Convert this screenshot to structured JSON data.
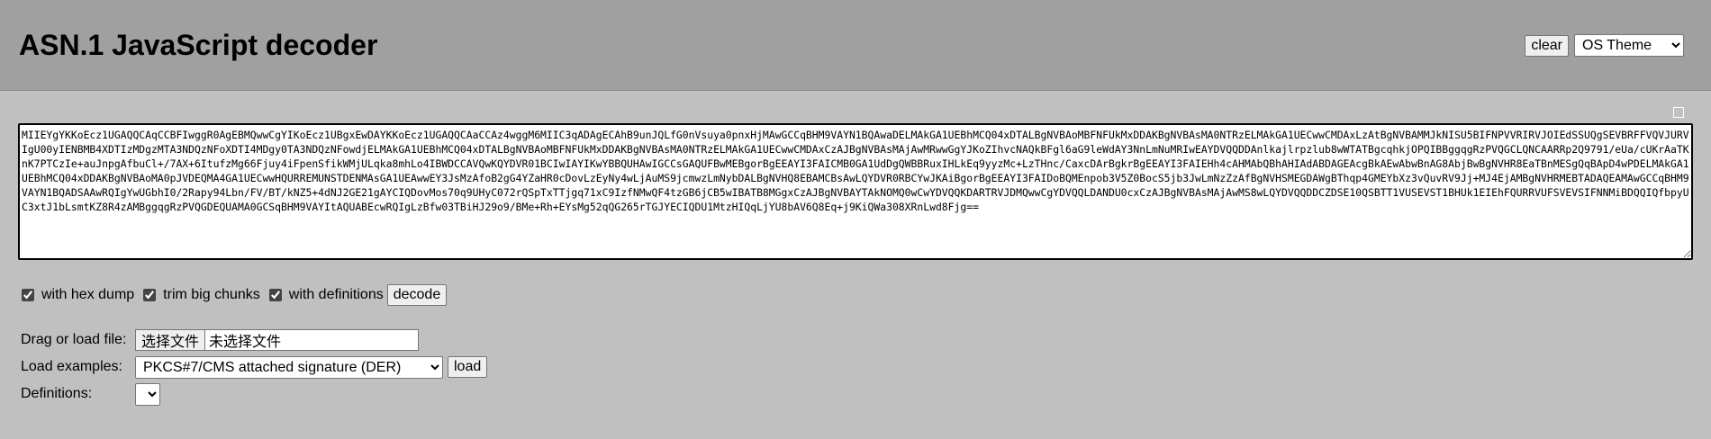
{
  "header": {
    "title": "ASN.1 JavaScript decoder",
    "clear_label": "clear",
    "theme_selected": "OS Theme"
  },
  "input": {
    "value": "MIIEYgYKKoEcz1UGAQQCAqCCBFIwggR0AgEBMQwwCgYIKoEcz1UBgxEwDAYKKoEcz1UGAQQCAaCCAz4wggM6MIIC3qADAgECAhB9unJQLfG0nVsuya0pnxHjMAwGCCqBHM9VAYN1BQAwaDELMAkGA1UEBhMCQ04xDTALBgNVBAoMBFNFUkMxDDAKBgNVBAsMA0NTRzELMAkGA1UECwwCMDAxLzAtBgNVBAMMJkNISU5BIFNPVVRIRVJOIEdSSUQgSEVBRFFVQVJURVIgU00yIENBMB4XDTIzMDgzMTA3NDQzNFoXDTI4MDgy0TA3NDQzNFowdjELMAkGA1UEBhMCQ04xDTALBgNVBAoMBFNFUkMxDDAKBgNVBAsMA0NTRzELMAkGA1UECwwCMDAxCzAJBgNVBAsMAjAwMRwwGgYJKoZIhvcNAQkBFgl6aG9leWdAY3NnLmNuMRIwEAYDVQQDDAnlkajlrpzlub8wWTATBgcqhkjOPQIBBggqgRzPVQGCLQNCAARRp2Q9791/eUa/cUKrAaTKnK7PTCzIe+auJnpgAfbuCl+/7AX+6ItufzMg66Fjuy4iFpenSfikWMjULqka8mhLo4IBWDCCAVQwKQYDVR01BCIwIAYIKwYBBQUHAwIGCCsGAQUFBwMEBgorBgEEAYI3FAICMB0GA1UdDgQWBBRuxIHLkEq9yyzMc+LzTHnc/CaxcDArBgkrBgEEAYI3FAIEHh4cAHMAbQBhAHIAdABDAGEAcgBkAEwAbwBnAG8AbjBwBgNVHR8EaTBnMESgQqBApD4wPDELMAkGA1UEBhMCQ04xDDAKBgNVBAoMA0pJVDEQMA4GA1UECwwHQURREMUNSTDENMAsGA1UEAwwEY3JsMzAfoB2gG4YZaHR0cDovLzEyNy4wLjAuMS9jcmwzLmNybDALBgNVHQ8EBAMCBsAwLQYDVR0RBCYwJKAiBgorBgEEAYI3FAIDoBQMEnpob3V5Z0BocS5jb3JwLmNzZzAfBgNVHSMEGDAWgBThqp4GMEYbXz3vQuvRV9Jj+MJ4EjAMBgNVHRMEBTADAQEAMAwGCCqBHM9VAYN1BQADSAAwRQIgYwUGbhI0/2Rapy94Lbn/FV/BT/kNZ5+4dNJ2GE21gAYCIQDovMos70q9UHyC072rQSpTxTTjgq71xC9IzfNMwQF4tzGB6jCB5wIBATB8MGgxCzAJBgNVBAYTAkNOMQ0wCwYDVQQKDARTRVJDMQwwCgYDVQQLDANDU0cxCzAJBgNVBAsMAjAwMS8wLQYDVQQDDCZDSE10QSBTT1VUSEVST1BHUk1EIEhFQURRVUFSVEVSIFNNMiBDQQIQfbpyUC3xtJ1bLsmtKZ8R4zAMBggqgRzPVQGDEQUAMA0GCSqBHM9VAYItAQUABEcwRQIgLzBfw03TBiHJ29o9/BMe+Rh+EYsMg52qQG265rTGJYECIQDU1MtzHIQqLjYU8bAV6Q8Eq+j9KiQWa308XRnLwd8Fjg=="
  },
  "options": {
    "hex_dump_label": "with hex dump",
    "trim_label": "trim big chunks",
    "definitions_label": "with definitions",
    "decode_label": "decode"
  },
  "file": {
    "label": "Drag or load file:",
    "button_label": "选择文件",
    "status": "未选择文件"
  },
  "examples": {
    "label": "Load examples:",
    "selected": "PKCS#7/CMS attached signature (DER)",
    "load_label": "load"
  },
  "definitions": {
    "label": "Definitions:"
  }
}
